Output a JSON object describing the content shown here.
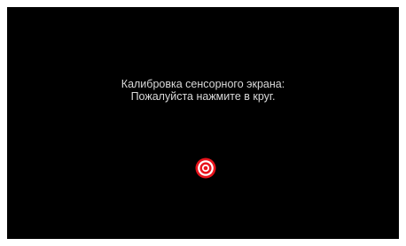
{
  "calibration": {
    "line1": "Калибровка сенсорного экрана:",
    "line2": "Пожалуйста нажмите в круг."
  },
  "target": {
    "icon": "bullseye-target-icon",
    "ring_color": "#e8141c",
    "gap_color": "#ffffff"
  },
  "colors": {
    "background": "#000000",
    "text": "#d9d9d9"
  }
}
